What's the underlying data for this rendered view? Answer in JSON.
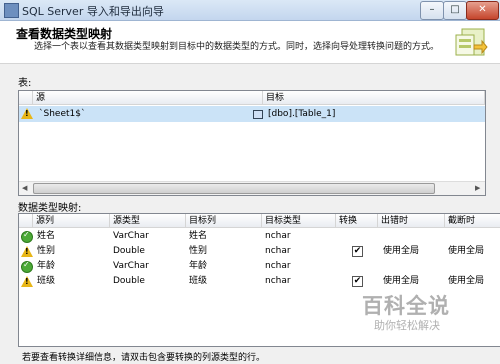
{
  "window": {
    "title": "SQL Server 导入和导出向导",
    "min": "–",
    "max": "□",
    "close": "✕"
  },
  "header": {
    "title": "查看数据类型映射",
    "description": "选择一个表以查看其数据类型映射到目标中的数据类型的方式。同时，选择向导处理转换问题的方式。"
  },
  "tables_section": {
    "label": "表:",
    "columns": [
      "源",
      "目标"
    ],
    "rows": [
      {
        "status": "warning",
        "source": "`Sheet1$`",
        "target": "[dbo].[Table_1]"
      }
    ]
  },
  "mapping_section": {
    "label": "数据类型映射:",
    "columns": [
      "源列",
      "源类型",
      "目标列",
      "目标类型",
      "转换",
      "出错时",
      "截断时"
    ],
    "rows": [
      {
        "status": "ok",
        "source_col": "姓名",
        "source_type": "VarChar",
        "dest_col": "姓名",
        "dest_type": "nchar",
        "convert": false,
        "on_error": "",
        "on_truncate": ""
      },
      {
        "status": "warning",
        "source_col": "性别",
        "source_type": "Double",
        "dest_col": "性别",
        "dest_type": "nchar",
        "convert": true,
        "on_error": "使用全局",
        "on_truncate": "使用全局"
      },
      {
        "status": "ok",
        "source_col": "年龄",
        "source_type": "VarChar",
        "dest_col": "年龄",
        "dest_type": "nchar",
        "convert": false,
        "on_error": "",
        "on_truncate": ""
      },
      {
        "status": "warning",
        "source_col": "班级",
        "source_type": "Double",
        "dest_col": "班级",
        "dest_type": "nchar",
        "convert": true,
        "on_error": "使用全局",
        "on_truncate": "使用全局"
      }
    ]
  },
  "footer": {
    "hint": "若要查看转换详细信息，请双击包含要转换的列源类型的行。"
  },
  "watermark": {
    "brand": "百科全说",
    "tagline": "助你轻松解决"
  }
}
